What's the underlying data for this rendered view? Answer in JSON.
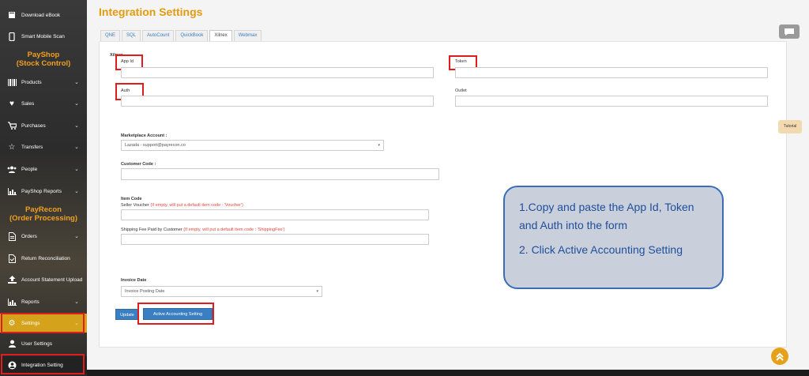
{
  "sidebar": {
    "items_top": [
      {
        "label": "Download eBook",
        "icon": "book-icon"
      },
      {
        "label": "Smart Mobile Scan",
        "icon": "mobile-icon"
      }
    ],
    "section_payshop": {
      "line1": "PayShop",
      "line2": "(Stock Control)"
    },
    "payshop_items": [
      {
        "label": "Products",
        "icon": "barcode-icon",
        "chevron": "⌄"
      },
      {
        "label": "Sales",
        "icon": "heart-icon",
        "chevron": "⌄"
      },
      {
        "label": "Purchases",
        "icon": "cart-icon",
        "chevron": "⌄"
      },
      {
        "label": "Transfers",
        "icon": "star-icon",
        "chevron": "⌄"
      },
      {
        "label": "People",
        "icon": "users-icon",
        "chevron": "⌄"
      },
      {
        "label": "PayShop Reports",
        "icon": "bar-chart-icon",
        "chevron": "⌄"
      }
    ],
    "section_payrecon": {
      "line1": "PayRecon",
      "line2": "(Order Processing)"
    },
    "payrecon_items": [
      {
        "label": "Orders",
        "icon": "document-icon",
        "chevron": "⌄"
      },
      {
        "label": "Return Reconciliation",
        "icon": "return-doc-icon",
        "chevron": ""
      },
      {
        "label": "Account Statement Upload",
        "icon": "upload-icon",
        "chevron": ""
      },
      {
        "label": "Reports",
        "icon": "bar-chart-icon",
        "chevron": "⌄"
      }
    ],
    "settings": {
      "label": "Settings",
      "chevron": "⌄"
    },
    "user_settings": {
      "label": "User Settings"
    },
    "integration_setting": {
      "label": "Integration Setting"
    }
  },
  "page": {
    "title": "Integration Settings"
  },
  "tabs": [
    "QNE",
    "SQL",
    "AutoCount",
    "QuickBook",
    "Xilnex",
    "Webmax"
  ],
  "active_tab": "Xilnex",
  "form": {
    "section_label": "Xilnex",
    "app_id_label": "App Id",
    "token_label": "Token",
    "auth_label": "Auth",
    "outlet_label": "Outlet",
    "marketplace_label": "Marketplace Account :",
    "marketplace_value": "Lazada - support@payrecon.co",
    "customer_code_label": "Customer Code :",
    "item_code_label": "Item Code",
    "seller_voucher_label": "Seller Voucher",
    "seller_voucher_hint": "(If empty, will put a default item code : 'Voucher')",
    "shipping_fee_label": "Shipping Fee Paid by Customer",
    "shipping_fee_hint": "(If empty, will put a default item code : 'ShippingFee')",
    "invoice_date_label": "Invoice Date",
    "invoice_date_value": "Invoice Posting Date",
    "update_button": "Update",
    "active_accounting_button": "Active Accounting Setting"
  },
  "callout": {
    "line1": "1.Copy and paste the App Id, Token and Auth into the form",
    "line2": "2. Click Active Accounting Setting"
  },
  "tutorial_label": "Tutorial",
  "colors": {
    "accent": "#e39a0e",
    "button": "#3a7fc1",
    "highlight": "#e01c1c",
    "settings_bg": "#d4a21b"
  }
}
